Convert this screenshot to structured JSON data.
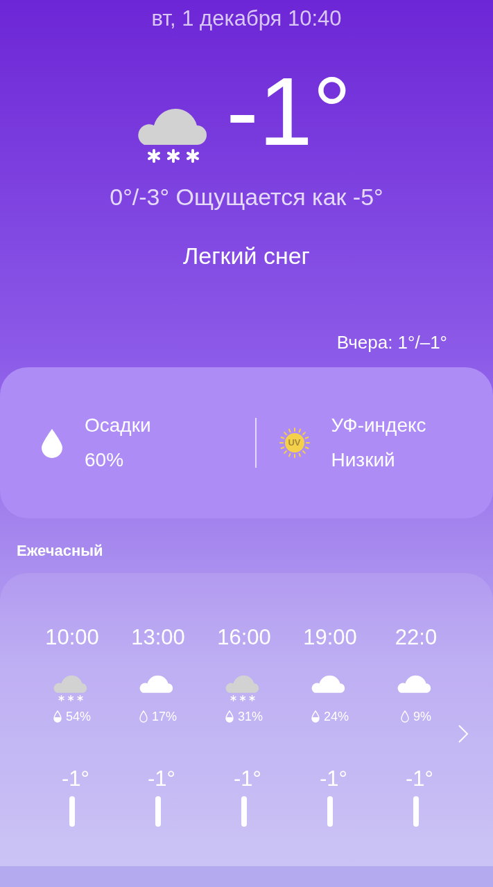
{
  "date": "вт, 1 декабря 10:40",
  "current": {
    "kind": "snow",
    "temperature": "-1°",
    "range_feels": "0°/-3° Ощущается как -5°",
    "condition": "Легкий снег",
    "yesterday": "Вчера: 1°/–1°"
  },
  "details": [
    {
      "kind": "precipitation",
      "label": "Осадки",
      "value": "60%"
    },
    {
      "kind": "uv",
      "label": "УФ-индекс",
      "value": "Низкий",
      "badge": "UV"
    }
  ],
  "hourly": {
    "title": "Ежечасный",
    "hours": [
      {
        "time": "10:00",
        "kind": "snow",
        "drop_filled": true,
        "chance": "54%",
        "temperature": "-1°"
      },
      {
        "time": "13:00",
        "kind": "cloud",
        "drop_filled": false,
        "chance": "17%",
        "temperature": "-1°"
      },
      {
        "time": "16:00",
        "kind": "snow",
        "drop_filled": true,
        "chance": "31%",
        "temperature": "-1°"
      },
      {
        "time": "19:00",
        "kind": "cloud",
        "drop_filled": true,
        "chance": "24%",
        "temperature": "-1°"
      },
      {
        "time": "22:0",
        "kind": "cloud",
        "drop_filled": false,
        "chance": "9%",
        "temperature": "-1°"
      }
    ]
  }
}
